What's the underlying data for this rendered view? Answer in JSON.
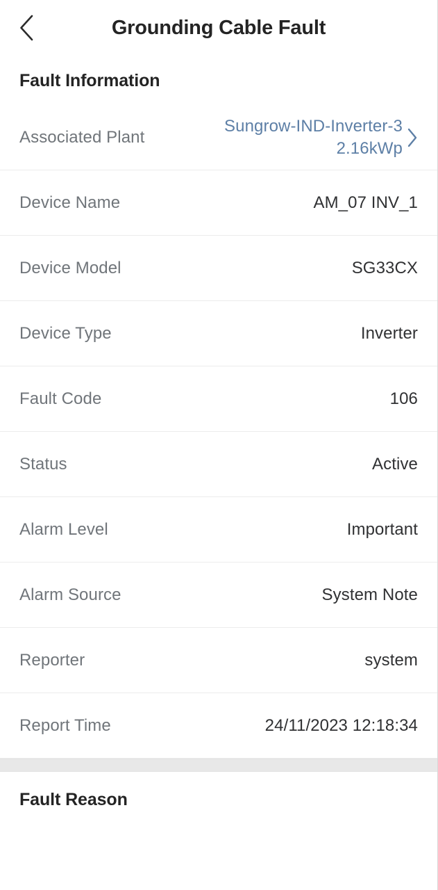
{
  "header": {
    "title": "Grounding Cable Fault",
    "back_icon": "chevron-left-icon"
  },
  "fault_information": {
    "heading": "Fault Information",
    "rows": [
      {
        "label": "Associated Plant",
        "value": "Sungrow-IND-Inverter-32.16kWp",
        "type": "link",
        "chevron_icon": "chevron-right-icon"
      },
      {
        "label": "Device Name",
        "value": "AM_07 INV_1",
        "type": "text"
      },
      {
        "label": "Device Model",
        "value": "SG33CX",
        "type": "text"
      },
      {
        "label": "Device Type",
        "value": "Inverter",
        "type": "text"
      },
      {
        "label": "Fault Code",
        "value": "106",
        "type": "text"
      },
      {
        "label": "Status",
        "value": "Active",
        "type": "text"
      },
      {
        "label": "Alarm Level",
        "value": "Important",
        "type": "text"
      },
      {
        "label": "Alarm Source",
        "value": "System Note",
        "type": "text"
      },
      {
        "label": "Reporter",
        "value": "system",
        "type": "text"
      },
      {
        "label": "Report Time",
        "value": "24/11/2023 12:18:34",
        "type": "text"
      }
    ]
  },
  "fault_reason": {
    "heading": "Fault Reason"
  },
  "colors": {
    "link": "#5d7fa6",
    "label": "#70757a",
    "value": "#303133",
    "heading": "#242424",
    "divider": "#ececec",
    "band": "#e8e8e8",
    "background": "#ffffff"
  }
}
